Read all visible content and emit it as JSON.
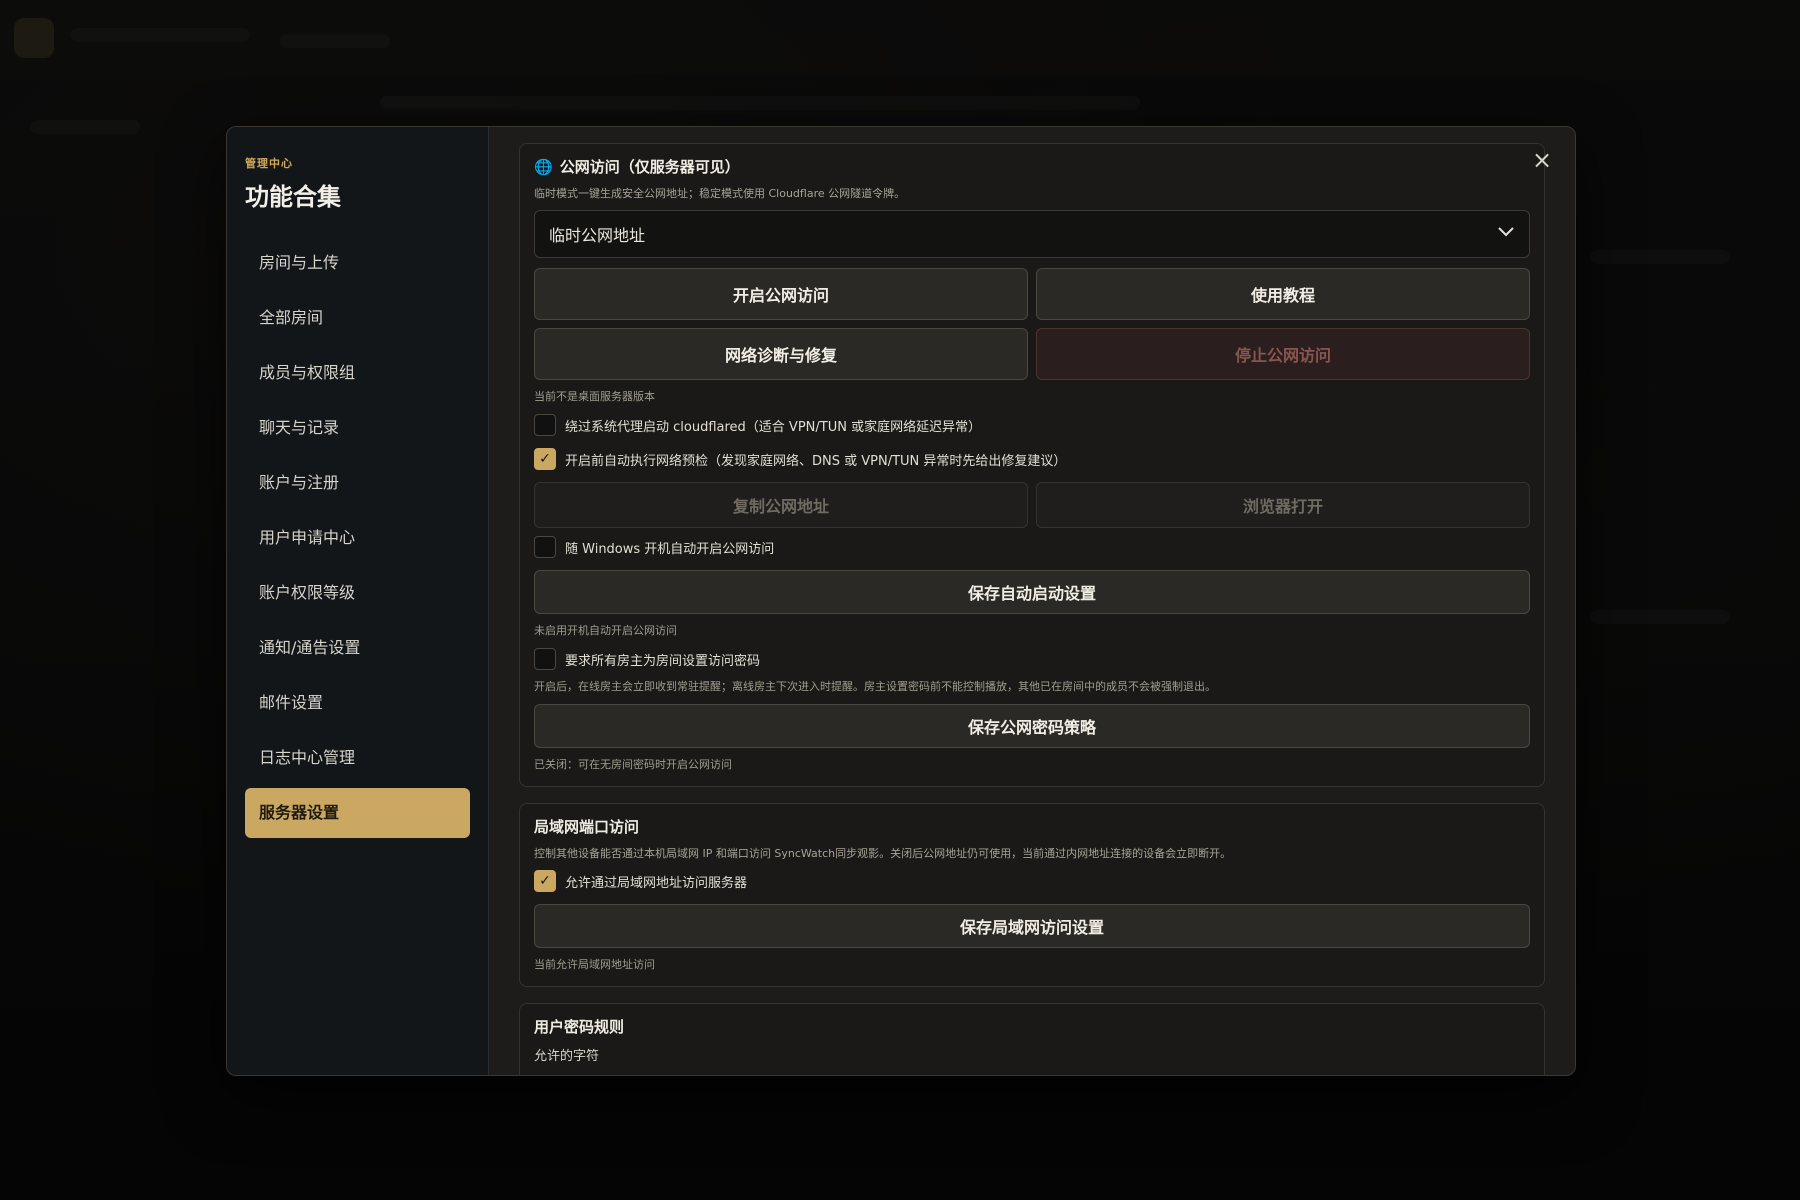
{
  "sidebar": {
    "kicker": "管理中心",
    "title": "功能合集",
    "items": [
      {
        "label": "房间与上传"
      },
      {
        "label": "全部房间"
      },
      {
        "label": "成员与权限组"
      },
      {
        "label": "聊天与记录"
      },
      {
        "label": "账户与注册"
      },
      {
        "label": "用户申请中心"
      },
      {
        "label": "账户权限等级"
      },
      {
        "label": "通知/通告设置"
      },
      {
        "label": "邮件设置"
      },
      {
        "label": "日志中心管理"
      },
      {
        "label": "服务器设置",
        "active": true
      }
    ]
  },
  "close_icon": "×",
  "public": {
    "title": "公网访问（仅服务器可见）",
    "subtitle": "临时模式一键生成安全公网地址；稳定模式使用 Cloudflare 公网隧道令牌。",
    "mode_selected": "临时公网地址",
    "btn_start": "开启公网访问",
    "btn_tutorial": "使用教程",
    "btn_diagnose": "网络诊断与修复",
    "btn_stop": "停止公网访问",
    "version_hint": "当前不是桌面服务器版本",
    "bypass_proxy_label": "绕过系统代理启动 cloudflared（适合 VPN/TUN 或家庭网络延迟异常）",
    "bypass_proxy_checked": false,
    "precheck_label": "开启前自动执行网络预检（发现家庭网络、DNS 或 VPN/TUN 异常时先给出修复建议）",
    "precheck_checked": true,
    "btn_copy": "复制公网地址",
    "btn_browser": "浏览器打开",
    "autostart_label": "随 Windows 开机自动开启公网访问",
    "autostart_checked": false,
    "btn_save_autostart": "保存自动启动设置",
    "autostart_hint": "未启用开机自动开启公网访问",
    "require_pwd_label": "要求所有房主为房间设置访问密码",
    "require_pwd_checked": false,
    "require_pwd_note": "开启后，在线房主会立即收到常驻提醒；离线房主下次进入时提醒。房主设置密码前不能控制播放，其他已在房间中的成员不会被强制退出。",
    "btn_save_pwd_policy": "保存公网密码策略",
    "pwd_policy_hint": "已关闭：可在无房间密码时开启公网访问"
  },
  "lan": {
    "title": "局域网端口访问",
    "subtitle": "控制其他设备能否通过本机局域网 IP 和端口访问 SyncWatch同步观影。关闭后公网地址仍可使用，当前通过内网地址连接的设备会立即断开。",
    "allow_label": "允许通过局域网地址访问服务器",
    "allow_checked": true,
    "btn_save": "保存局域网访问设置",
    "hint": "当前允许局域网地址访问"
  },
  "pwd_rules": {
    "title": "用户密码规则",
    "sub": "允许的字符"
  },
  "colors": {
    "accent": "#caa862",
    "globe": "#4da3e0",
    "danger_text": "#8a5550"
  }
}
